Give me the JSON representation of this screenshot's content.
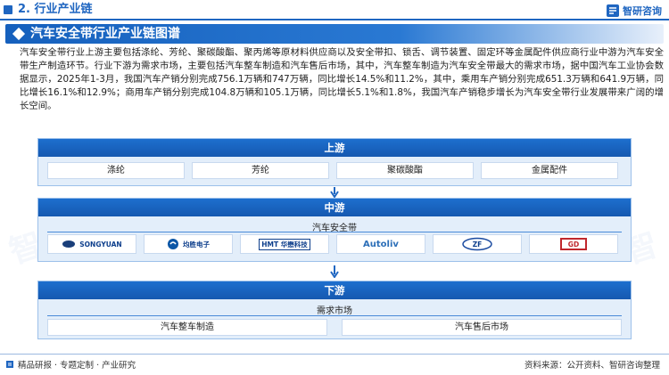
{
  "header": {
    "section_label": "2. 行业产业链",
    "brand_name": "智研咨询",
    "title": "汽车安全带行业产业链图谱"
  },
  "intro": "汽车安全带行业上游主要包括涤纶、芳纶、聚碳酸酯、聚丙烯等原材料供应商以及安全带扣、锁舌、调节装置、固定环等金属配件供应商行业中游为汽车安全带生产制造环节。行业下游为需求市场，主要包括汽车整车制造和汽车售后市场，其中，汽车整车制造为汽车安全带最大的需求市场，据中国汽车工业协会数据显示，2025年1-3月，我国汽车产销分别完成756.1万辆和747万辆，同比增长14.5%和11.2%，其中，乘用车产销分别完成651.3万辆和641.9万辆，同比增长16.1%和12.9%；商用车产销分别完成104.8万辆和105.1万辆，同比增长5.1%和1.8%，我国汽车产销稳步增长为汽车安全带行业发展带来广阔的增长空间。",
  "upstream": {
    "label": "上游",
    "items": [
      "涤纶",
      "芳纶",
      "聚碳酸酯",
      "金属配件"
    ]
  },
  "midstream": {
    "label": "中游",
    "sub_label": "汽车安全带",
    "companies": [
      {
        "name": "SONGYUAN",
        "icon": "songyuan-logo"
      },
      {
        "name": "均胜电子",
        "sub": "JOYSON ELECTRONICS",
        "icon": "joyson-logo"
      },
      {
        "name": "HMT 华懋科技",
        "icon": "hmt-logo"
      },
      {
        "name": "Autoliv",
        "icon": "autoliv-logo"
      },
      {
        "name": "ZF",
        "icon": "zf-logo"
      },
      {
        "name": "GD",
        "icon": "gd-logo"
      }
    ]
  },
  "downstream": {
    "label": "下游",
    "sub_label": "需求市场",
    "items": [
      "汽车整车制造",
      "汽车售后市场"
    ]
  },
  "footer": {
    "left": "精品研报 · 专题定制 · 产业研究",
    "right": "资料来源：公开资料、智研咨询整理"
  },
  "colors": {
    "primary": "#1f66c1",
    "panel": "#e3eefa"
  }
}
